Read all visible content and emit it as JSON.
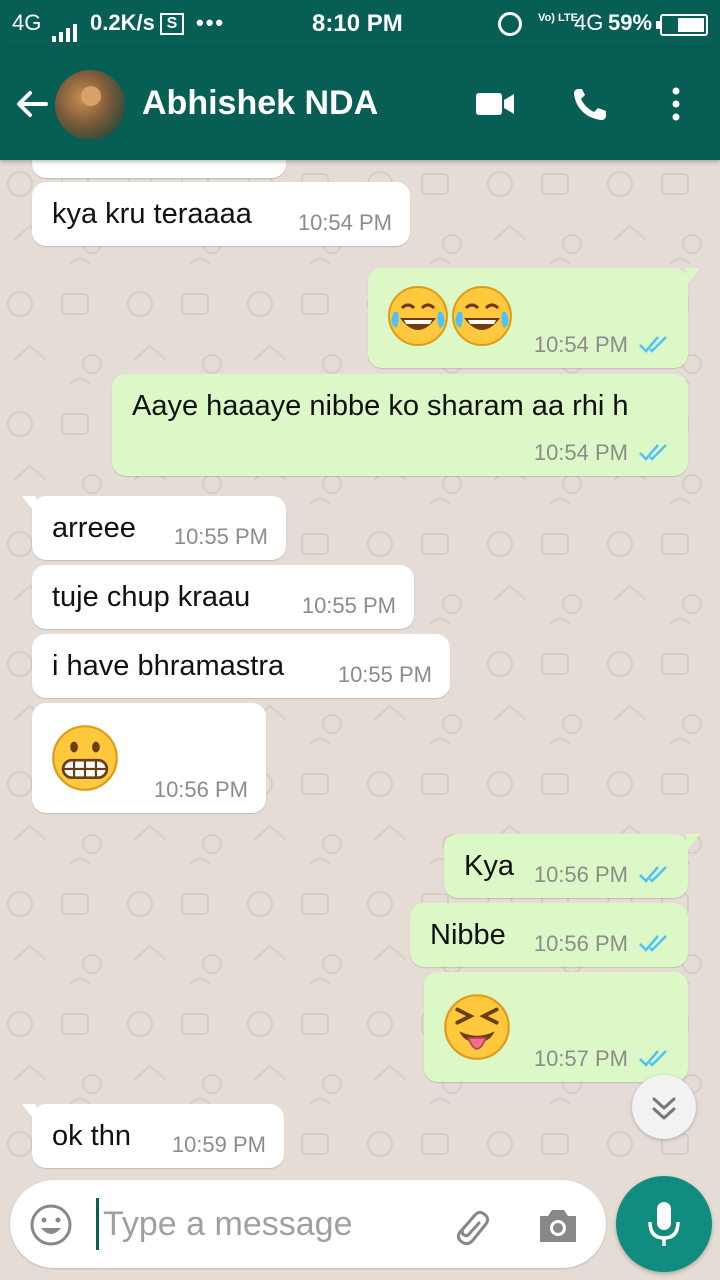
{
  "status_bar": {
    "network": "4G",
    "speed": "0.2K/s",
    "s_badge": "S",
    "dots": "•••",
    "time": "8:10 PM",
    "volte": "Vo) LTE",
    "network_right": "4G",
    "battery": "59%"
  },
  "header": {
    "contact_name": "Abhishek NDA"
  },
  "messages": [
    {
      "dir": "in",
      "text": "kya kru teraaaa",
      "time": "10:54 PM"
    },
    {
      "dir": "out",
      "emoji": "tears-of-joy x2",
      "time": "10:54 PM"
    },
    {
      "dir": "out",
      "text": "Aaye haaaye nibbe ko sharam aa rhi h",
      "time": "10:54 PM"
    },
    {
      "dir": "in",
      "text": "arreee",
      "time": "10:55 PM"
    },
    {
      "dir": "in",
      "text": "tuje chup kraau",
      "time": "10:55 PM"
    },
    {
      "dir": "in",
      "text": "i have bhramastra",
      "time": "10:55 PM"
    },
    {
      "dir": "in",
      "emoji": "grimacing-face",
      "time": "10:56 PM"
    },
    {
      "dir": "out",
      "text": "Kya",
      "time": "10:56 PM"
    },
    {
      "dir": "out",
      "text": "Nibbe",
      "time": "10:56 PM"
    },
    {
      "dir": "out",
      "emoji": "squinting-tongue-face",
      "time": "10:57 PM"
    },
    {
      "dir": "in",
      "text": "ok thn",
      "time": "10:59 PM"
    }
  ],
  "input": {
    "placeholder": "Type a message",
    "value": ""
  },
  "colors": {
    "header": "#075e54",
    "outgoing_bubble": "#dcf8c6",
    "incoming_bubble": "#ffffff",
    "wallpaper": "#e5ddd5",
    "mic_button": "#128c7e",
    "read_ticks": "#4fc3f7"
  }
}
